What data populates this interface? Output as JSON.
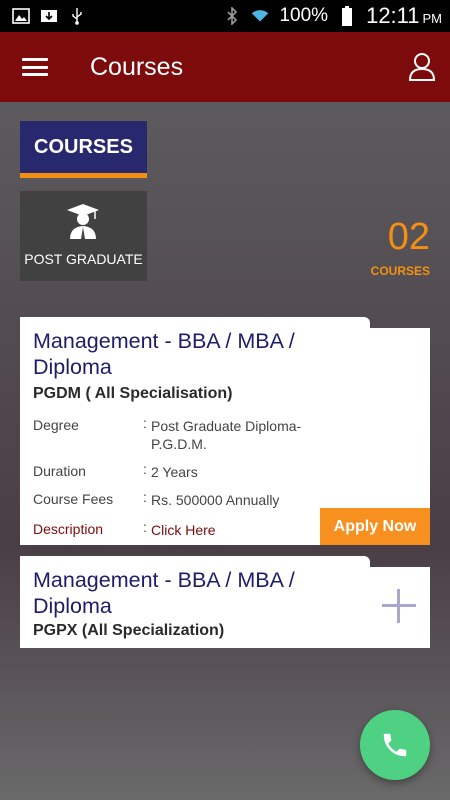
{
  "status_bar": {
    "battery_percent": "100%",
    "time": "12:11",
    "ampm": "PM",
    "left_icons": [
      "image-icon",
      "download-icon",
      "usb-icon"
    ],
    "right_icons": [
      "bluetooth-icon",
      "wifi-icon",
      "battery-icon"
    ]
  },
  "app_bar": {
    "title": "Courses",
    "color": "#7d0b0b"
  },
  "tabs": {
    "courses_label": "COURSES",
    "post_graduate_label": "POST GRADUATE"
  },
  "count": {
    "number": "02",
    "label": "COURSES",
    "color": "#f39013"
  },
  "courses": [
    {
      "title": "Management - BBA / MBA / Diploma",
      "subtitle": "PGDM  ( All Specialisation)",
      "details": [
        {
          "key": "Degree",
          "value": "Post Graduate Diploma-P.G.D.M."
        },
        {
          "key": "Duration",
          "value": "2 Years"
        },
        {
          "key": "Course Fees",
          "value": "Rs. 500000 Annually"
        },
        {
          "key": "Description",
          "value": "Click Here"
        }
      ],
      "apply_label": "Apply Now"
    },
    {
      "title": "Management - BBA / MBA / Diploma",
      "subtitle": "PGPX (All Specialization)"
    }
  ],
  "colors": {
    "title_blue": "#1d1d6b",
    "accent_orange": "#f7901e",
    "fab_green": "#4fd184"
  }
}
